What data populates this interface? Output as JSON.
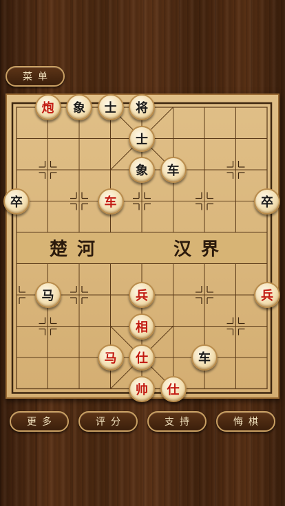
{
  "menu": {
    "label": "菜单"
  },
  "river": {
    "left": "楚河",
    "right": "汉界"
  },
  "bottom_buttons": [
    {
      "label": "更多"
    },
    {
      "label": "评分"
    },
    {
      "label": "支持"
    },
    {
      "label": "悔棋"
    }
  ],
  "colors": {
    "red": "#c21b12",
    "black": "#1a1a1a",
    "board": "#d9b67b",
    "frame": "#9a6b33"
  },
  "pieces": [
    {
      "side": "red",
      "char": "炮",
      "file": 1,
      "rank": 0
    },
    {
      "side": "black",
      "char": "象",
      "file": 2,
      "rank": 0
    },
    {
      "side": "black",
      "char": "士",
      "file": 3,
      "rank": 0
    },
    {
      "side": "black",
      "char": "将",
      "file": 4,
      "rank": 0
    },
    {
      "side": "black",
      "char": "士",
      "file": 4,
      "rank": 1
    },
    {
      "side": "black",
      "char": "象",
      "file": 4,
      "rank": 2
    },
    {
      "side": "black",
      "char": "车",
      "file": 5,
      "rank": 2
    },
    {
      "side": "black",
      "char": "卒",
      "file": 0,
      "rank": 3
    },
    {
      "side": "red",
      "char": "车",
      "file": 3,
      "rank": 3
    },
    {
      "side": "black",
      "char": "卒",
      "file": 8,
      "rank": 3
    },
    {
      "side": "black",
      "char": "马",
      "file": 1,
      "rank": 6
    },
    {
      "side": "red",
      "char": "兵",
      "file": 4,
      "rank": 6
    },
    {
      "side": "red",
      "char": "兵",
      "file": 8,
      "rank": 6
    },
    {
      "side": "red",
      "char": "相",
      "file": 4,
      "rank": 7
    },
    {
      "side": "red",
      "char": "马",
      "file": 3,
      "rank": 8
    },
    {
      "side": "red",
      "char": "仕",
      "file": 4,
      "rank": 8
    },
    {
      "side": "black",
      "char": "车",
      "file": 6,
      "rank": 8
    },
    {
      "side": "red",
      "char": "帅",
      "file": 4,
      "rank": 9
    },
    {
      "side": "red",
      "char": "仕",
      "file": 5,
      "rank": 9
    }
  ]
}
